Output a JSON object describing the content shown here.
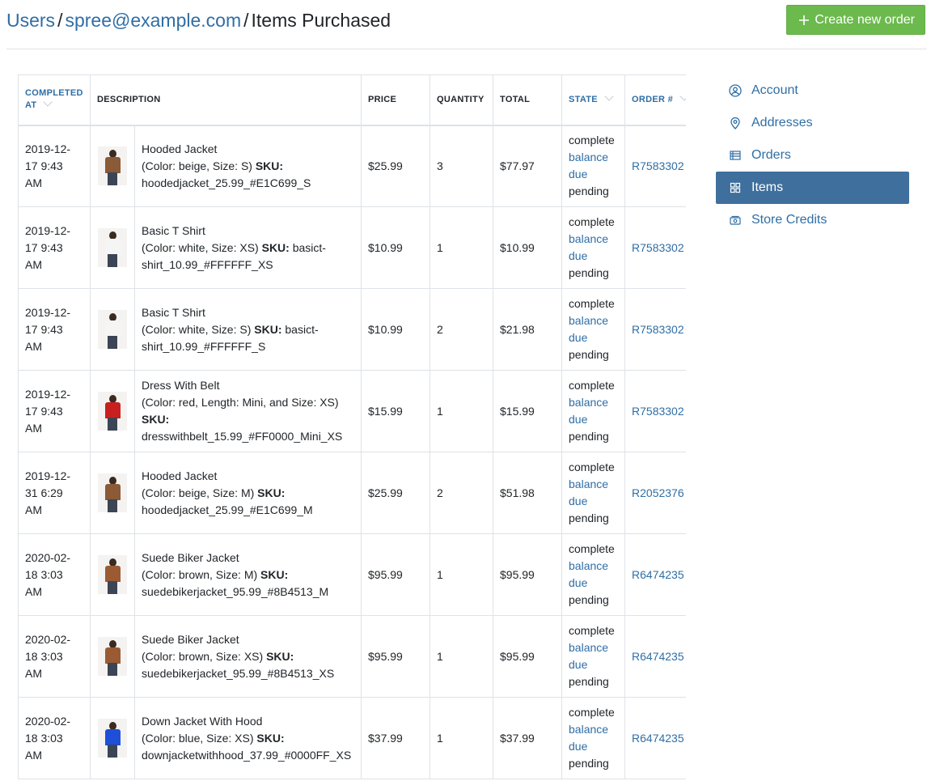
{
  "breadcrumb": {
    "users": "Users",
    "sep1": "/",
    "email": "spree@example.com",
    "sep2": "/",
    "current": "Items Purchased"
  },
  "actions": {
    "create_order": "Create new order"
  },
  "table": {
    "headers": {
      "completed_at_line1": "COMPLETED",
      "completed_at_line2": "AT",
      "description": "DESCRIPTION",
      "price": "PRICE",
      "quantity": "QUANTITY",
      "total": "TOTAL",
      "state": "STATE",
      "order": "ORDER #"
    },
    "rows": [
      {
        "date1": "2019-12-",
        "date2": "17 9:43",
        "date3": "AM",
        "name": "Hooded Jacket",
        "variant": "(Color: beige, Size: S) ",
        "sku_label": "SKU:",
        "sku": "hoodedjacket_25.99_#E1C699_S",
        "price": "$25.99",
        "qty": "3",
        "total": "$77.97",
        "state": "complete",
        "payment1": "balance",
        "payment2": "due",
        "shipment": "pending",
        "order": "R7583302",
        "thumb_color": "#8b5a36"
      },
      {
        "date1": "2019-12-",
        "date2": "17 9:43",
        "date3": "AM",
        "name": "Basic T Shirt",
        "variant": "(Color: white, Size: XS) ",
        "sku_label": "SKU:",
        "sku": "basict-shirt_10.99_#FFFFFF_XS",
        "price": "$10.99",
        "qty": "1",
        "total": "$10.99",
        "state": "complete",
        "payment1": "balance",
        "payment2": "due",
        "shipment": "pending",
        "order": "R7583302",
        "thumb_color": "#f5f5f5"
      },
      {
        "date1": "2019-12-",
        "date2": "17 9:43",
        "date3": "AM",
        "name": "Basic T Shirt",
        "variant": "(Color: white, Size: S) ",
        "sku_label": "SKU:",
        "sku": "basict-shirt_10.99_#FFFFFF_S",
        "price": "$10.99",
        "qty": "2",
        "total": "$21.98",
        "state": "complete",
        "payment1": "balance",
        "payment2": "due",
        "shipment": "pending",
        "order": "R7583302",
        "thumb_color": "#f5f5f5"
      },
      {
        "date1": "2019-12-",
        "date2": "17 9:43",
        "date3": "AM",
        "name": "Dress With Belt",
        "variant": "(Color: red, Length: Mini, and Size: XS) ",
        "sku_label": "SKU:",
        "sku": "dresswithbelt_15.99_#FF0000_Mini_XS",
        "price": "$15.99",
        "qty": "1",
        "total": "$15.99",
        "state": "complete",
        "payment1": "balance",
        "payment2": "due",
        "shipment": "pending",
        "order": "R7583302",
        "thumb_color": "#c8201e"
      },
      {
        "date1": "2019-12-",
        "date2": "31 6:29",
        "date3": "AM",
        "name": "Hooded Jacket",
        "variant": "(Color: beige, Size: M) ",
        "sku_label": "SKU:",
        "sku": "hoodedjacket_25.99_#E1C699_M",
        "price": "$25.99",
        "qty": "2",
        "total": "$51.98",
        "state": "complete",
        "payment1": "balance",
        "payment2": "due",
        "shipment": "pending",
        "order": "R2052376",
        "thumb_color": "#8b5a36"
      },
      {
        "date1": "2020-02-",
        "date2": "18 3:03",
        "date3": "AM",
        "name": "Suede Biker Jacket",
        "variant": "(Color: brown, Size: M) ",
        "sku_label": "SKU:",
        "sku": "suedebikerjacket_95.99_#8B4513_M",
        "price": "$95.99",
        "qty": "1",
        "total": "$95.99",
        "state": "complete",
        "payment1": "balance",
        "payment2": "due",
        "shipment": "pending",
        "order": "R6474235",
        "thumb_color": "#9a5b34"
      },
      {
        "date1": "2020-02-",
        "date2": "18 3:03",
        "date3": "AM",
        "name": "Suede Biker Jacket",
        "variant": "(Color: brown, Size: XS) ",
        "sku_label": "SKU:",
        "sku": "suedebikerjacket_95.99_#8B4513_XS",
        "price": "$95.99",
        "qty": "1",
        "total": "$95.99",
        "state": "complete",
        "payment1": "balance",
        "payment2": "due",
        "shipment": "pending",
        "order": "R6474235",
        "thumb_color": "#9a5b34"
      },
      {
        "date1": "2020-02-",
        "date2": "18 3:03",
        "date3": "AM",
        "name": "Down Jacket With Hood",
        "variant": "(Color: blue, Size: XS) ",
        "sku_label": "SKU:",
        "sku": "downjacketwithhood_37.99_#0000FF_XS",
        "price": "$37.99",
        "qty": "1",
        "total": "$37.99",
        "state": "complete",
        "payment1": "balance",
        "payment2": "due",
        "shipment": "pending",
        "order": "R6474235",
        "thumb_color": "#1f4fd8"
      }
    ]
  },
  "sidebar": {
    "items": [
      {
        "label": "Account",
        "icon": "account-icon",
        "active": false
      },
      {
        "label": "Addresses",
        "icon": "map-pin-icon",
        "active": false
      },
      {
        "label": "Orders",
        "icon": "list-icon",
        "active": false
      },
      {
        "label": "Items",
        "icon": "grid-icon",
        "active": true
      },
      {
        "label": "Store Credits",
        "icon": "money-icon",
        "active": false
      }
    ]
  },
  "colors": {
    "link": "#2f6ea5",
    "primary_button": "#6cba4e",
    "active_nav": "#3f6f9c"
  }
}
